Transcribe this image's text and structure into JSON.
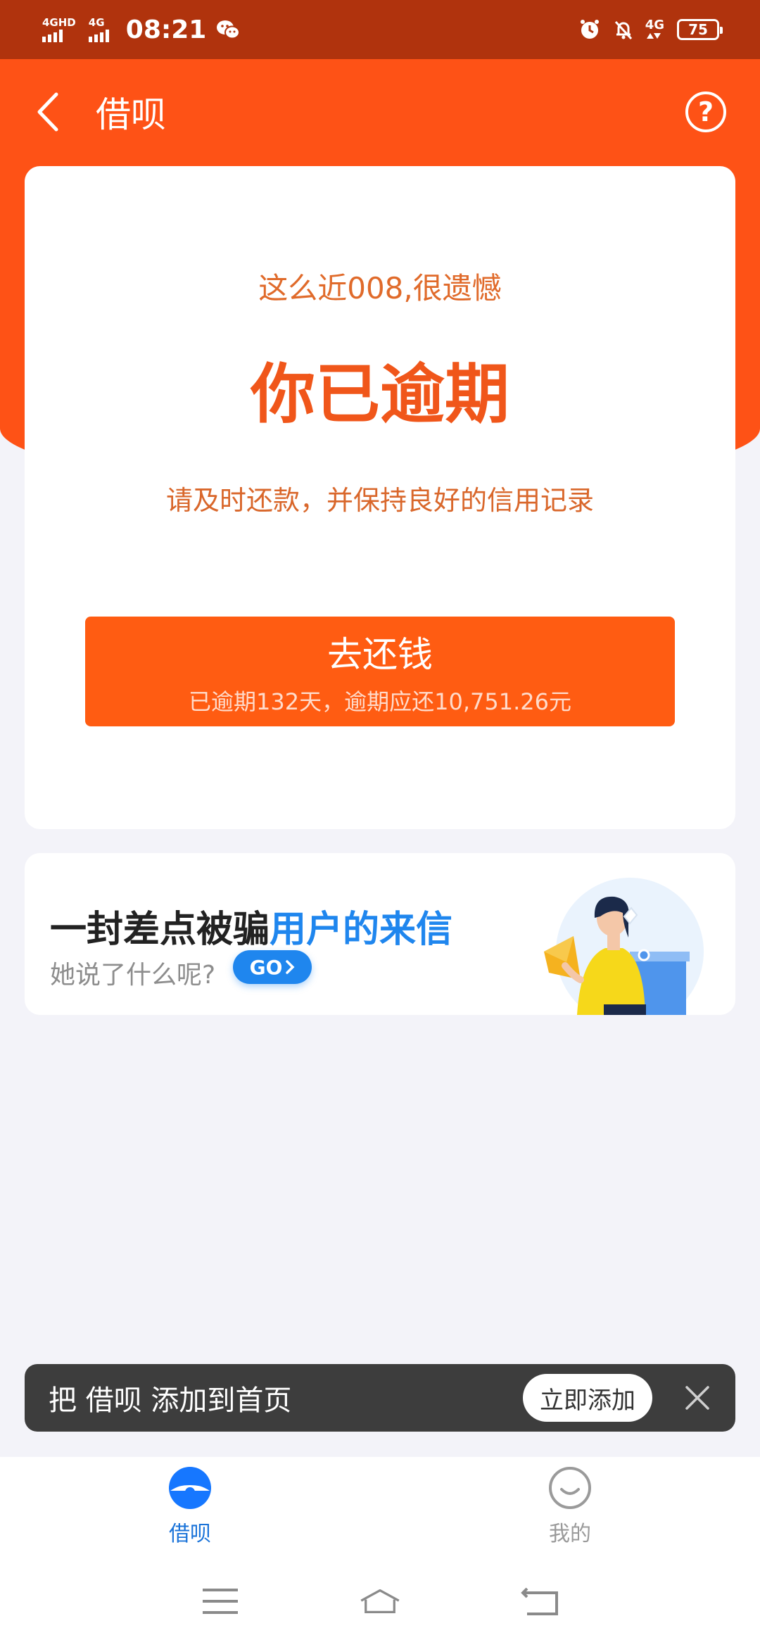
{
  "status_bar": {
    "signal1_label": "4GHD",
    "signal2_label": "4G",
    "time": "08:21",
    "network": "4G",
    "battery": "75"
  },
  "nav": {
    "title": "借呗"
  },
  "main_card": {
    "subtitle": "这么近008,很遗憾",
    "title": "你已逾期",
    "tip": "请及时还款，并保持良好的信用记录",
    "repay_button": {
      "label": "去还钱",
      "detail": "已逾期132天，逾期应还10,751.26元"
    }
  },
  "banner": {
    "title_part1": "一封差点被骗",
    "title_part2": "用户的来信",
    "subtitle": "她说了什么呢?",
    "go_label": "GO"
  },
  "toast": {
    "text": "把 借呗 添加到首页",
    "button": "立即添加"
  },
  "tabbar": {
    "items": [
      {
        "label": "借呗",
        "icon": "jiebei-icon",
        "active": true
      },
      {
        "label": "我的",
        "icon": "smile-face-icon",
        "active": false
      }
    ]
  },
  "colors": {
    "header": "#fe5216",
    "status_bar": "#b0330d",
    "accent_orange": "#ff5c12",
    "accent_blue": "#1f86ee",
    "toast_bg": "#3d3d3d"
  }
}
